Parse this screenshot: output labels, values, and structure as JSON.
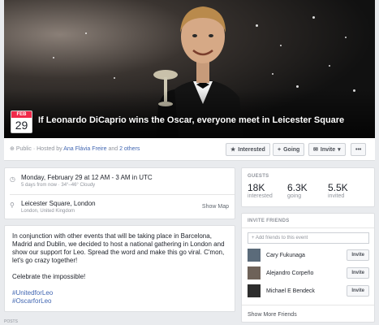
{
  "event": {
    "month": "FEB",
    "day": "29",
    "title": "If Leonardo DiCaprio wins the Oscar, everyone meet in Leicester Square",
    "privacy": "Public",
    "hosted_by_prefix": " · Hosted by ",
    "host_name": "Ana Flávia Freire",
    "host_suffix": " and ",
    "host_others": "2 others"
  },
  "actions": {
    "interested": "Interested",
    "going": "Going",
    "invite": "Invite",
    "more": "•••"
  },
  "details": {
    "datetime": "Monday, February 29 at 12 AM - 3 AM in UTC",
    "datetime_sub": "5 days from now · 34°–46° Cloudy",
    "location": "Leicester Square, London",
    "location_sub": "London, United Kingdom",
    "show_map": "Show Map"
  },
  "description": {
    "paragraph1": "In conjunction with other events that will be taking place in Barcelona, Madrid and Dublin, we decided to host a national gathering in London and show our support for Leo. Spread the word and make this go viral. C'mon, let's go crazy together!",
    "paragraph2": "Celebrate the impossible!",
    "hashtag1": "#UnitedforLeo",
    "hashtag2": "#OscarforLeo"
  },
  "guests": {
    "header": "GUESTS",
    "stats": [
      {
        "count": "18K",
        "label": "interested"
      },
      {
        "count": "6.3K",
        "label": "going"
      },
      {
        "count": "5.5K",
        "label": "invited"
      }
    ]
  },
  "invite_friends": {
    "header": "INVITE FRIENDS",
    "placeholder": "Add friends to this event",
    "button_label": "Invite",
    "friends": [
      {
        "name": "Cary Fukunaga"
      },
      {
        "name": "Alejandro Corpeño"
      },
      {
        "name": "Michael E Bendeck"
      }
    ],
    "show_more": "Show More Friends"
  },
  "footer": {
    "label": "POSTS"
  }
}
